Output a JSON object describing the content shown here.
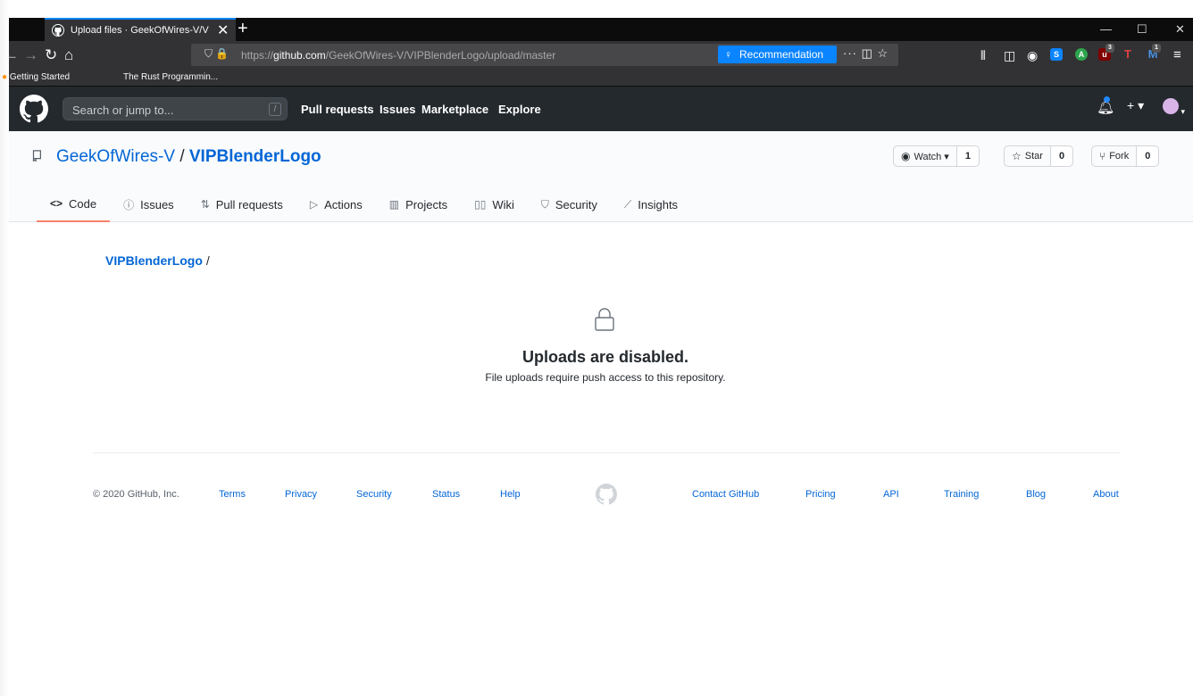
{
  "browser": {
    "tab_title": "Upload files · GeekOfWires-V/V",
    "new_tab": "+",
    "window_controls": {
      "minimize": "—",
      "maximize": "☐",
      "close": "✕"
    },
    "url_prefix": "https://",
    "url_host": "github.com",
    "url_path": "/GeekOfWires-V/VIPBlenderLogo/upload/master",
    "recommendation": "Recommendation",
    "url_more": "···",
    "bookmarks": [
      "Getting Started",
      "The Rust Programmin..."
    ],
    "ext_badges": {
      "ublock": "3",
      "mail": "1"
    }
  },
  "header": {
    "search_placeholder": "Search or jump to...",
    "search_shortcut": "/",
    "nav": [
      "Pull requests",
      "Issues",
      "Marketplace",
      "Explore"
    ],
    "plus": "+ ▾"
  },
  "repo": {
    "owner": "GeekOfWires-V",
    "separator": "/",
    "name": "VIPBlenderLogo",
    "watch_label": "Watch ▾",
    "watch_count": "1",
    "star_label": "Star",
    "star_count": "0",
    "fork_label": "Fork",
    "fork_count": "0",
    "tabs": [
      "Code",
      "Issues",
      "Pull requests",
      "Actions",
      "Projects",
      "Wiki",
      "Security",
      "Insights"
    ]
  },
  "content": {
    "breadcrumb_link": "VIPBlenderLogo",
    "breadcrumb_sep": "/",
    "title": "Uploads are disabled.",
    "subtitle": "File uploads require push access to this repository."
  },
  "footer": {
    "copyright": "© 2020 GitHub, Inc.",
    "left_links": [
      "Terms",
      "Privacy",
      "Security",
      "Status",
      "Help"
    ],
    "right_links": [
      "Contact GitHub",
      "Pricing",
      "API",
      "Training",
      "Blog",
      "About"
    ]
  },
  "colors": {
    "link": "#0366d6",
    "header_bg": "#24292e",
    "active_tab_underline": "#f9826c",
    "browser_accent": "#0a84ff"
  }
}
